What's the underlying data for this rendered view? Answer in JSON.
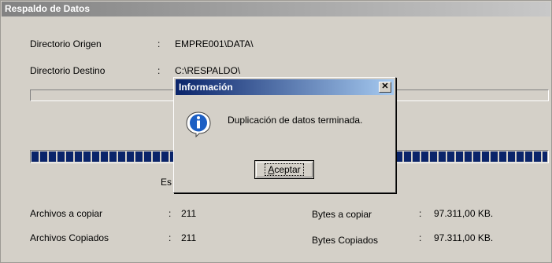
{
  "window": {
    "title": "Respaldo de Datos"
  },
  "fields": {
    "origen_label": "Directorio Origen",
    "origen_value": "EMPRE001\\DATA\\",
    "destino_label": "Directorio Destino",
    "destino_value": "C:\\RESPALDO\\",
    "colon": ":"
  },
  "progress": {
    "file_fraction": 0,
    "total_fraction": 1
  },
  "status_text_partial": "Es",
  "stats": {
    "archivos_copiar_label": "Archivos a copiar",
    "archivos_copiar_value": "211",
    "archivos_copiados_label": "Archivos Copiados",
    "archivos_copiados_value": "211",
    "bytes_copiar_label": "Bytes a copiar",
    "bytes_copiar_value": "97.311,00 KB.",
    "bytes_copiados_label": "Bytes Copiados",
    "bytes_copiados_value": "97.311,00 KB."
  },
  "dialog": {
    "title": "Información",
    "close_glyph": "✕",
    "message": "Duplicación de datos terminada.",
    "ok_first": "A",
    "ok_rest": "ceptar",
    "icon": "info-icon"
  },
  "colors": {
    "face": "#d4d0c8",
    "dialog_title": "#0a246a",
    "window_title": "#828282",
    "progress": "#0a246a"
  }
}
